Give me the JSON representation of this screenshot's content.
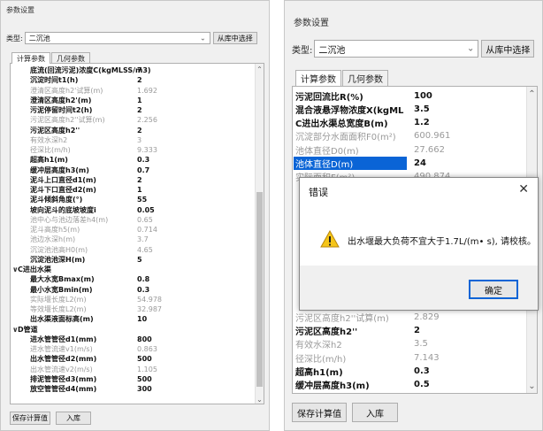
{
  "left": {
    "title": "参数设置",
    "type_label": "类型:",
    "type_value": "二沉池",
    "choose_btn": "从库中选择",
    "tabs": [
      "计算参数",
      "几何参数"
    ],
    "rows": [
      {
        "l": "底流(回流污泥)浓度C(kgMLSS/m3)",
        "v": "7",
        "s": "bold",
        "grp": false
      },
      {
        "l": "沉淀时间t1(h)",
        "v": "2",
        "s": "bold",
        "grp": false
      },
      {
        "l": "澄清区高度h2'试算(m)",
        "v": "1.692",
        "s": "dim",
        "grp": false
      },
      {
        "l": "澄清区高度h2'(m)",
        "v": "1",
        "s": "bold",
        "grp": false
      },
      {
        "l": "污泥停留时间t2(h)",
        "v": "2",
        "s": "bold",
        "grp": false
      },
      {
        "l": "污泥区高度h2''试算(m)",
        "v": "2.256",
        "s": "dim",
        "grp": false
      },
      {
        "l": "污泥区高度h2''",
        "v": "2",
        "s": "bold",
        "grp": false
      },
      {
        "l": "有效水深h2",
        "v": "3",
        "s": "dim",
        "grp": false
      },
      {
        "l": "径深比(m/h)",
        "v": "9.333",
        "s": "dim",
        "grp": false
      },
      {
        "l": "超高h1(m)",
        "v": "0.3",
        "s": "bold",
        "grp": false
      },
      {
        "l": "缓冲层高度h3(m)",
        "v": "0.7",
        "s": "bold",
        "grp": false
      },
      {
        "l": "泥斗上口直径d1(m)",
        "v": "2",
        "s": "bold",
        "grp": false
      },
      {
        "l": "泥斗下口直径d2(m)",
        "v": "1",
        "s": "bold",
        "grp": false
      },
      {
        "l": "泥斗倾斜角度(°)",
        "v": "55",
        "s": "bold",
        "grp": false
      },
      {
        "l": "坡向泥斗的底坡坡度i",
        "v": "0.05",
        "s": "bold",
        "grp": false
      },
      {
        "l": "池中心与池边落差h4(m)",
        "v": "0.65",
        "s": "dim",
        "grp": false
      },
      {
        "l": "泥斗高度h5(m)",
        "v": "0.714",
        "s": "dim",
        "grp": false
      },
      {
        "l": "池边水深h(m)",
        "v": "3.7",
        "s": "dim",
        "grp": false
      },
      {
        "l": "沉淀池池高H0(m)",
        "v": "4.65",
        "s": "dim",
        "grp": false
      },
      {
        "l": "沉淀池池深H(m)",
        "v": "5",
        "s": "bold",
        "grp": false
      },
      {
        "l": "C进出水渠",
        "v": "",
        "s": "",
        "grp": true
      },
      {
        "l": "最大水宽Bmax(m)",
        "v": "0.8",
        "s": "bold",
        "grp": false
      },
      {
        "l": "最小水宽Bmin(m)",
        "v": "0.3",
        "s": "bold",
        "grp": false
      },
      {
        "l": "实际堰长度L2(m)",
        "v": "54.978",
        "s": "dim",
        "grp": false
      },
      {
        "l": "等效堰长度L2(m)",
        "v": "32.987",
        "s": "dim",
        "grp": false
      },
      {
        "l": "出水渠液面标高(m)",
        "v": "10",
        "s": "bold",
        "grp": false
      },
      {
        "l": "D管道",
        "v": "",
        "s": "",
        "grp": true
      },
      {
        "l": "进水管管径d1(mm)",
        "v": "800",
        "s": "bold",
        "grp": false
      },
      {
        "l": "进水管流速v1(m/s)",
        "v": "0.863",
        "s": "dim",
        "grp": false
      },
      {
        "l": "出水管管径d2(mm)",
        "v": "500",
        "s": "bold",
        "grp": false
      },
      {
        "l": "出水管流速v2(m/s)",
        "v": "1.105",
        "s": "dim",
        "grp": false
      },
      {
        "l": "排泥管管径d3(mm)",
        "v": "500",
        "s": "bold",
        "grp": false
      },
      {
        "l": "放空管管径d4(mm)",
        "v": "300",
        "s": "bold",
        "grp": false
      }
    ],
    "save_btn": "保存计算值",
    "store_btn": "入库"
  },
  "right": {
    "title": "参数设置",
    "type_label": "类型:",
    "type_value": "二沉池",
    "choose_btn": "从库中选择",
    "tabs": [
      "计算参数",
      "几何参数"
    ],
    "rows": [
      {
        "l": "污泥回流比R(%)",
        "v": "100",
        "s": "bold"
      },
      {
        "l": "混合液悬浮物浓度X(kgML",
        "v": "3.5",
        "s": "bold"
      },
      {
        "l": "C进出水渠总宽度B(m)",
        "v": "1.2",
        "s": "bold"
      },
      {
        "l": "沉淀部分水面面积F0(m²)",
        "v": "600.961",
        "s": "dim"
      },
      {
        "l": "池体直径D0(m)",
        "v": "27.662",
        "s": "dim"
      },
      {
        "l": "池体直径D(m)",
        "v": "24",
        "s": "sel"
      },
      {
        "l": "实际面积F(m²)",
        "v": "490.874",
        "s": "dim"
      },
      {
        "l": "污泥区高度h2''试算(m)",
        "v": "2.829",
        "s": "dim"
      },
      {
        "l": "污泥区高度h2''",
        "v": "2",
        "s": "bold"
      },
      {
        "l": "有效水深h2",
        "v": "3.5",
        "s": "dim"
      },
      {
        "l": "径深比(m/h)",
        "v": "7.143",
        "s": "dim"
      },
      {
        "l": "超高h1(m)",
        "v": "0.3",
        "s": "bold"
      },
      {
        "l": "缓冲层高度h3(m)",
        "v": "0.5",
        "s": "bold"
      }
    ],
    "save_btn": "保存计算值",
    "store_btn": "入库"
  },
  "dialog": {
    "title": "错误",
    "message": "出水堰最大负荷不宜大于1.7L/(m• s), 请校核。",
    "ok_label": "确定"
  }
}
